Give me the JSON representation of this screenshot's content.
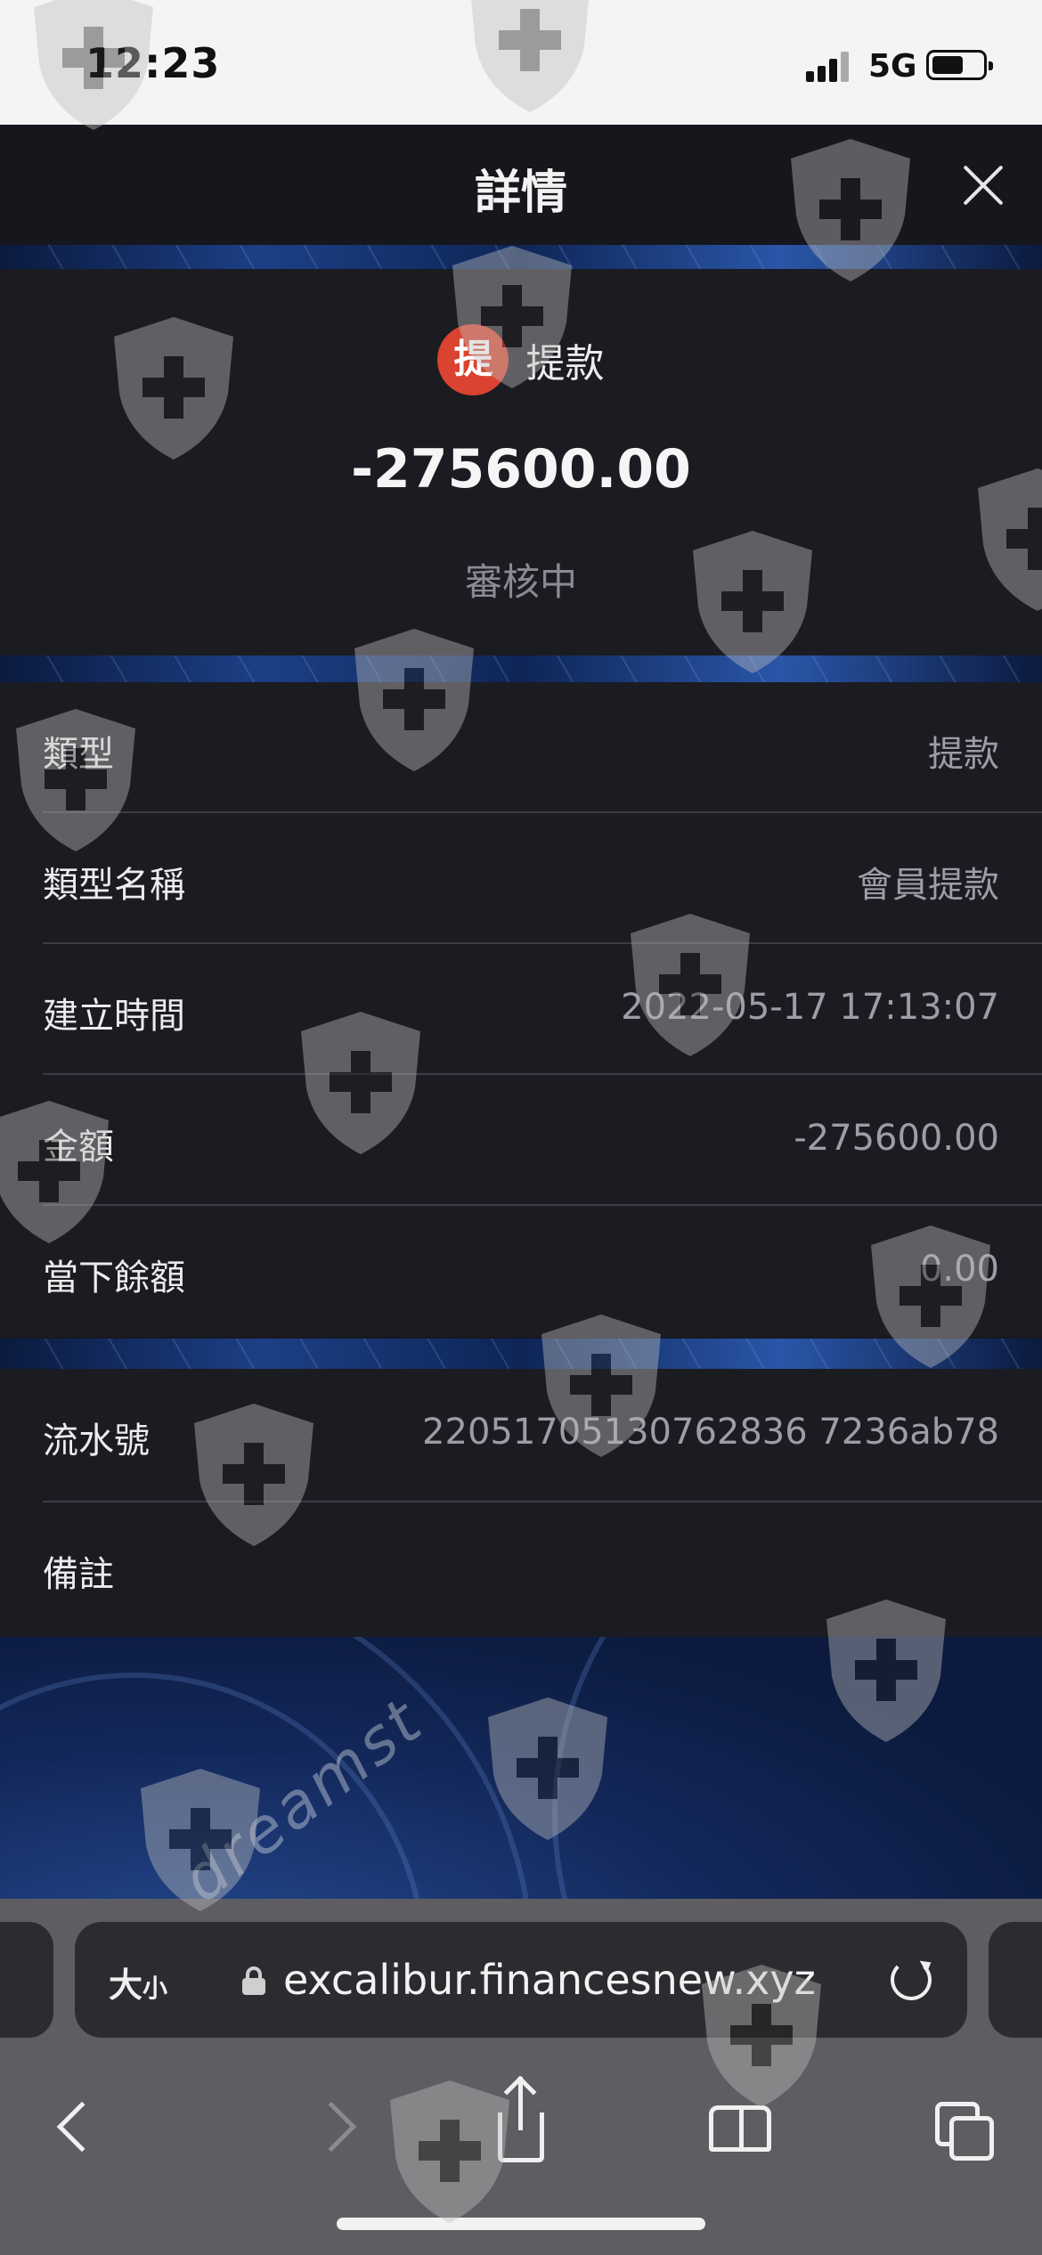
{
  "status_bar": {
    "time": "12:23",
    "network": "5G"
  },
  "header": {
    "title": "詳情"
  },
  "summary": {
    "badge": "提",
    "type_label": "提款",
    "amount": "-275600.00",
    "status": "審核中"
  },
  "details": [
    {
      "label": "類型",
      "value": "提款"
    },
    {
      "label": "類型名稱",
      "value": "會員提款"
    },
    {
      "label": "建立時間",
      "value": "2022-05-17 17:13:07"
    },
    {
      "label": "金額",
      "value": "-275600.00"
    },
    {
      "label": "當下餘額",
      "value": "0.00"
    }
  ],
  "extra": [
    {
      "label": "流水號",
      "value": "22051705130762836 7236ab78"
    },
    {
      "label": "備註",
      "value": ""
    }
  ],
  "watermark_text": "dreamst",
  "browser": {
    "text_size_label": "大",
    "text_size_small": "小",
    "url": "excalibur.financesnew.xyz"
  },
  "icons": [
    "close-icon",
    "lock-icon",
    "reload-icon",
    "back-icon",
    "forward-icon",
    "share-icon",
    "bookmarks-icon",
    "tabs-icon"
  ],
  "colors": {
    "badge": "#d9432f",
    "background": "#1b1b22",
    "accent_blue": "#1c3f86"
  }
}
